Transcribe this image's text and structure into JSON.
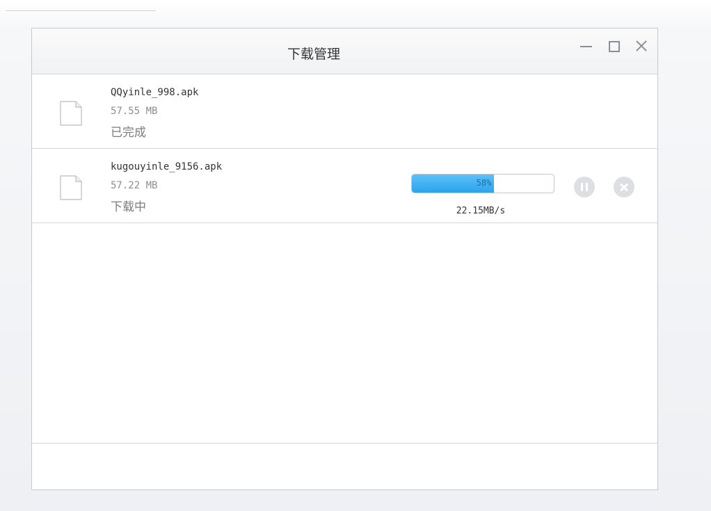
{
  "window": {
    "title": "下载管理"
  },
  "downloads": [
    {
      "name": "QQyinle_998.apk",
      "size": "57.55 MB",
      "status": "已完成",
      "icon": "file-icon"
    },
    {
      "name": "kugouyinle_9156.apk",
      "size": "57.22 MB",
      "status": "下载中",
      "icon": "file-icon",
      "progress_percent": 58,
      "progress_label": "58%",
      "speed": "22.15MB/s"
    }
  ],
  "colors": {
    "progress_fill": "#2aa4ec",
    "icon_gray": "#dddfe2"
  }
}
